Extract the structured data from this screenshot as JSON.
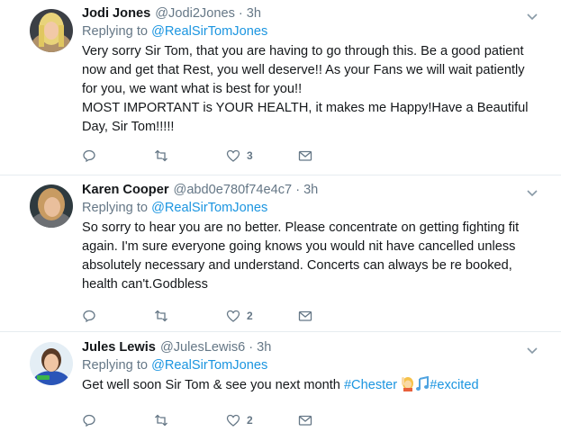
{
  "colors": {
    "link": "#1b95e0",
    "muted": "#657786",
    "text": "#14171a",
    "divider": "#e6ecf0"
  },
  "tweets": [
    {
      "name": "Jodi Jones",
      "handle": "@Jodi2Jones",
      "dot": "·",
      "time": "3h",
      "replying_prefix": "Replying to ",
      "replying_to": "@RealSirTomJones",
      "text_lines": [
        "Very sorry Sir Tom, that you are having to go through this. Be a good patient now and get that Rest, you well deserve!! As your Fans we will wait patiently for you, we want what is best for you!!",
        "MOST IMPORTANT is YOUR HEALTH, it makes me Happy!Have a Beautiful Day, Sir Tom!!!!!"
      ],
      "likes": "3"
    },
    {
      "name": "Karen Cooper",
      "handle": "@abd0e780f74e4c7",
      "dot": "·",
      "time": "3h",
      "replying_prefix": "Replying to ",
      "replying_to": "@RealSirTomJones",
      "text_lines": [
        "So sorry to hear you are no better. Please concentrate on getting fighting fit again. I'm sure everyone going knows you would nit have cancelled unless absolutely necessary and understand. Concerts can always be re booked, health can't.Godbless"
      ],
      "likes": "2"
    },
    {
      "name": "Jules Lewis",
      "handle": "@JulesLewis6",
      "dot": "·",
      "time": "3h",
      "replying_prefix": "Replying to ",
      "replying_to": "@RealSirTomJones",
      "text_before": "Get well soon Sir Tom & see you next month ",
      "hashtag1": "#Chester",
      "hashtag2": "#excited",
      "likes": "2"
    }
  ]
}
